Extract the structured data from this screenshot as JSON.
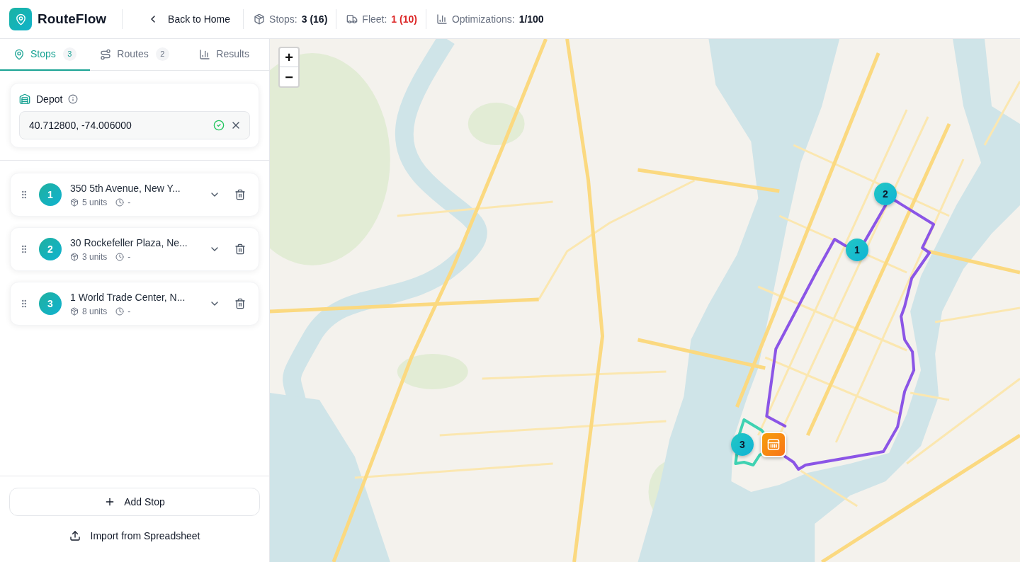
{
  "header": {
    "app_name": "RouteFlow",
    "back_link": "Back to Home",
    "stats": [
      {
        "kind": "stops",
        "label": "Stops:",
        "value": "3 (16)",
        "alert": false
      },
      {
        "kind": "fleet",
        "label": "Fleet:",
        "value": "1 (10)",
        "alert": true
      },
      {
        "kind": "optimizations",
        "label": "Optimizations:",
        "value": "1/100",
        "alert": false
      }
    ]
  },
  "sidebar": {
    "tabs": [
      {
        "kind": "stops",
        "label": "Stops",
        "count": "3",
        "selected": true
      },
      {
        "kind": "routes",
        "label": "Routes",
        "count": "2",
        "selected": false
      },
      {
        "kind": "results",
        "label": "Results",
        "selected": false
      }
    ],
    "depot": {
      "label": "Depot",
      "value": "40.712800, -74.006000",
      "valid": true
    },
    "stops": [
      {
        "number": "1",
        "address": "350 5th Avenue, New Y...",
        "units": "5 units",
        "time": "-"
      },
      {
        "number": "2",
        "address": "30 Rockefeller Plaza, Ne...",
        "units": "3 units",
        "time": "-"
      },
      {
        "number": "3",
        "address": "1 World Trade Center, N...",
        "units": "8 units",
        "time": "-"
      }
    ],
    "add_button": "Add Stop",
    "import_button": "Import from Spreadsheet"
  },
  "map": {
    "zoom_in": "+",
    "zoom_out": "−",
    "routes": [
      {
        "color": "#8b55e6"
      },
      {
        "color": "#3fd2b2"
      }
    ],
    "markers": [
      {
        "label": "1"
      },
      {
        "label": "2"
      },
      {
        "label": "3"
      }
    ]
  }
}
